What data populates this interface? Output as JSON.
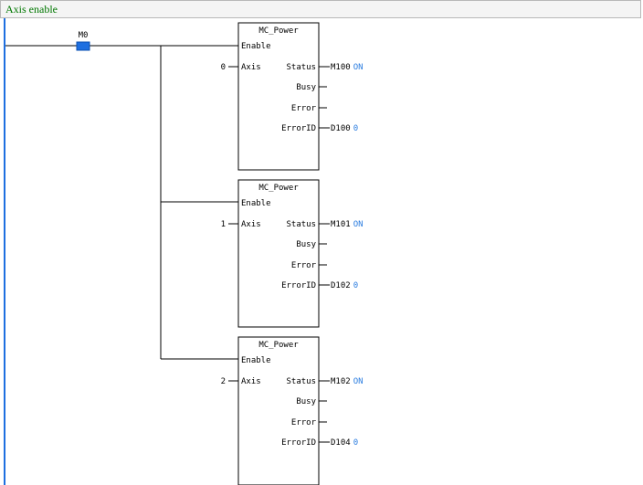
{
  "rung": {
    "comment": "Axis enable"
  },
  "contact": {
    "label": "M0"
  },
  "blocks": [
    {
      "title": "MC_Power",
      "enable_label": "Enable",
      "axis_label": "Axis",
      "axis_value": "0",
      "status_label": "Status",
      "status_var": "M100",
      "status_value": "ON",
      "busy_label": "Busy",
      "error_label": "Error",
      "errorid_label": "ErrorID",
      "errorid_var": "D100",
      "errorid_value": "0"
    },
    {
      "title": "MC_Power",
      "enable_label": "Enable",
      "axis_label": "Axis",
      "axis_value": "1",
      "status_label": "Status",
      "status_var": "M101",
      "status_value": "ON",
      "busy_label": "Busy",
      "error_label": "Error",
      "errorid_label": "ErrorID",
      "errorid_var": "D102",
      "errorid_value": "0"
    },
    {
      "title": "MC_Power",
      "enable_label": "Enable",
      "axis_label": "Axis",
      "axis_value": "2",
      "status_label": "Status",
      "status_var": "M102",
      "status_value": "ON",
      "busy_label": "Busy",
      "error_label": "Error",
      "errorid_label": "ErrorID",
      "errorid_var": "D104",
      "errorid_value": "0"
    }
  ],
  "colors": {
    "rail": "#1e6fe0",
    "contact_active": "#1e6fe0",
    "online_value": "#2b7de0",
    "comment": "#007700"
  }
}
